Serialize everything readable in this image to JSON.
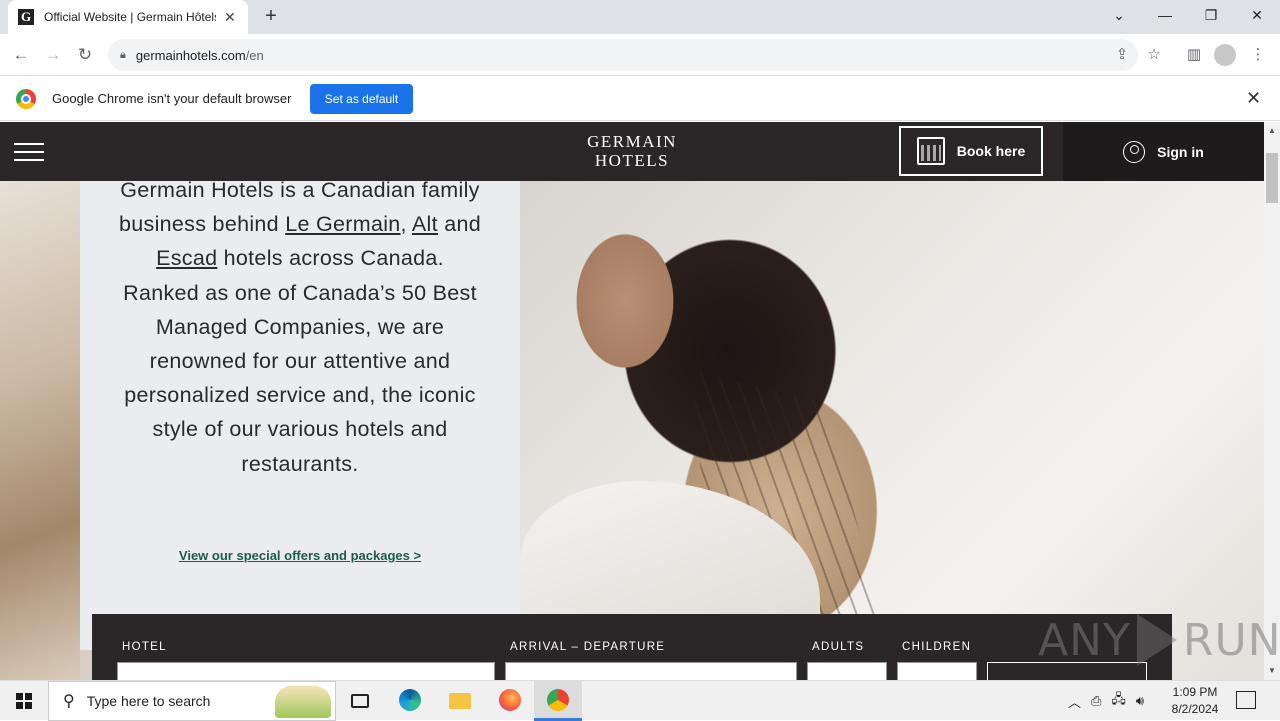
{
  "browser": {
    "tab_title": "Official Website | Germain Hôtels",
    "favicon_letter": "G",
    "tab_close": "✕",
    "new_tab": "+",
    "url_domain": "germainhotels.com",
    "url_path": "/en",
    "window_controls": {
      "dropdown": "⌄",
      "minimize": "—",
      "restore": "❐",
      "close": "✕"
    }
  },
  "infobar": {
    "message": "Google Chrome isn't your default browser",
    "button_label": "Set as default",
    "close": "✕"
  },
  "site_header": {
    "logo_line1": "GERMAIN",
    "logo_line2": "HOTELS",
    "book_label": "Book here",
    "signin_label": "Sign in"
  },
  "hero": {
    "text_part1": "Germain Hotels is a Canadian family business behind ",
    "link_le_germain": "Le Germain",
    "sep1": ", ",
    "link_alt": "Alt",
    "sep2": " and ",
    "link_escad": "Escad",
    "text_part2": " hotels across Canada. Ranked as one of Canada’s 50 Best Managed Companies, we are renowned for our attentive and personalized service and, the iconic style of our various hotels and restaurants.",
    "offers_link": "View our special offers and packages >"
  },
  "booking": {
    "hotel_label": "HOTEL",
    "dates_label": "ARRIVAL – DEPARTURE",
    "adults_label": "ADULTS",
    "children_label": "CHILDREN"
  },
  "watermark": {
    "left": "ANY",
    "right": "RUN"
  },
  "taskbar": {
    "search_placeholder": "Type here to search",
    "time": "1:09 PM",
    "date": "8/2/2024"
  },
  "colors": {
    "site_header_bg": "#2b2628",
    "chrome_blue": "#1a73e8",
    "offers_link": "#1d5a4c"
  }
}
